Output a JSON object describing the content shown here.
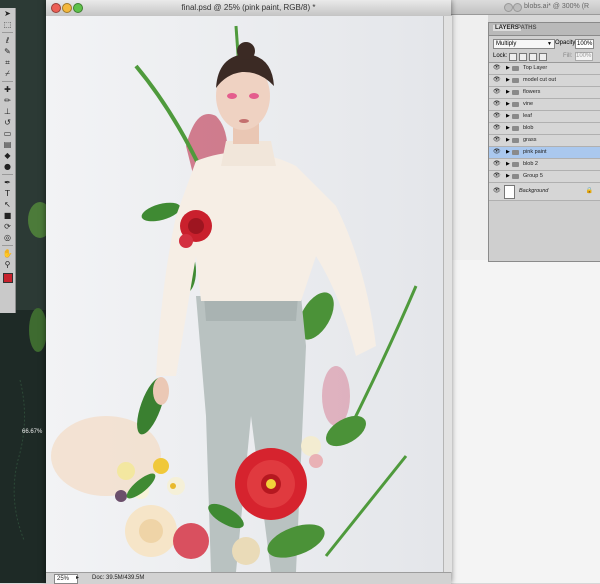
{
  "document": {
    "title": "final.psd @ 25% (pink paint, RGB/8) *",
    "zoom": "25%",
    "info": "Doc: 39.5M/439.5M"
  },
  "background_window": {
    "title": "blobs.ai* @ 300% (R",
    "zoom": "66.67%"
  },
  "tools": [
    {
      "icon": "move-icon",
      "glyph": "➤"
    },
    {
      "icon": "marquee-icon",
      "glyph": "⬚"
    },
    {
      "icon": "lasso-icon",
      "glyph": "ℓ"
    },
    {
      "icon": "quick-select-icon",
      "glyph": "✎"
    },
    {
      "icon": "crop-icon",
      "glyph": "⌗"
    },
    {
      "icon": "eyedropper-icon",
      "glyph": "⌿"
    },
    {
      "icon": "healing-brush-icon",
      "glyph": "✚"
    },
    {
      "icon": "brush-icon",
      "glyph": "✏"
    },
    {
      "icon": "clone-stamp-icon",
      "glyph": "⊥"
    },
    {
      "icon": "history-brush-icon",
      "glyph": "↺"
    },
    {
      "icon": "eraser-icon",
      "glyph": "▭"
    },
    {
      "icon": "gradient-icon",
      "glyph": "▤"
    },
    {
      "icon": "blur-icon",
      "glyph": "◆"
    },
    {
      "icon": "dodge-icon",
      "glyph": "●"
    },
    {
      "icon": "pen-icon",
      "glyph": "✒"
    },
    {
      "icon": "type-icon",
      "glyph": "T"
    },
    {
      "icon": "path-select-icon",
      "glyph": "↖"
    },
    {
      "icon": "shape-icon",
      "glyph": "■"
    },
    {
      "icon": "3d-rotate-icon",
      "glyph": "⟳"
    },
    {
      "icon": "3d-orbit-icon",
      "glyph": "◎"
    },
    {
      "icon": "hand-icon",
      "glyph": "✋"
    },
    {
      "icon": "zoom-icon",
      "glyph": "⚲"
    }
  ],
  "layers_panel": {
    "tabs": [
      "LAYERS",
      "PATHS"
    ],
    "blend_mode": "Multiply",
    "opacity_label": "Opacity:",
    "opacity": "100%",
    "lock_label": "Lock:",
    "fill_label": "Fill:",
    "fill": "100%",
    "layers": [
      {
        "name": "Top Layer",
        "selected": false
      },
      {
        "name": "model cut out",
        "selected": false
      },
      {
        "name": "flowers",
        "selected": false
      },
      {
        "name": "vine",
        "selected": false
      },
      {
        "name": "leaf",
        "selected": false
      },
      {
        "name": "blob",
        "selected": false
      },
      {
        "name": "grass",
        "selected": false
      },
      {
        "name": "pink paint",
        "selected": true
      },
      {
        "name": "blob 2",
        "selected": false
      },
      {
        "name": "Group 5",
        "selected": false
      }
    ],
    "background_layer": "Background"
  },
  "colors": {
    "foreground": "#c8222d",
    "selection": "#aac8ee"
  }
}
